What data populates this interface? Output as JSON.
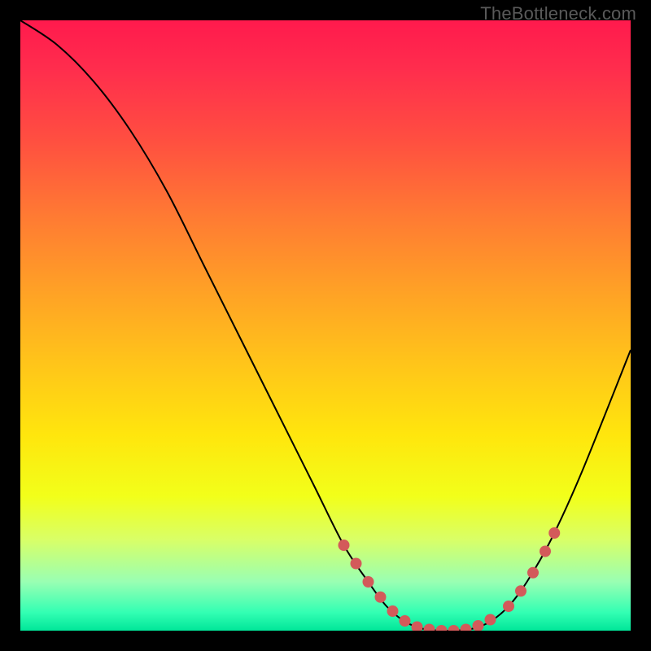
{
  "watermark": "TheBottleneck.com",
  "chart_data": {
    "type": "line",
    "title": "",
    "xlabel": "",
    "ylabel": "",
    "xlim": [
      0,
      100
    ],
    "ylim": [
      0,
      100
    ],
    "curve": [
      {
        "x": 0,
        "y": 100
      },
      {
        "x": 6,
        "y": 96
      },
      {
        "x": 12,
        "y": 90
      },
      {
        "x": 18,
        "y": 82
      },
      {
        "x": 24,
        "y": 72
      },
      {
        "x": 30,
        "y": 60
      },
      {
        "x": 36,
        "y": 48
      },
      {
        "x": 42,
        "y": 36
      },
      {
        "x": 48,
        "y": 24
      },
      {
        "x": 53,
        "y": 14
      },
      {
        "x": 57,
        "y": 8
      },
      {
        "x": 60,
        "y": 4
      },
      {
        "x": 63,
        "y": 1.5
      },
      {
        "x": 66,
        "y": 0.3
      },
      {
        "x": 70,
        "y": 0
      },
      {
        "x": 74,
        "y": 0.3
      },
      {
        "x": 77,
        "y": 1.5
      },
      {
        "x": 80,
        "y": 4
      },
      {
        "x": 83,
        "y": 8
      },
      {
        "x": 87,
        "y": 15
      },
      {
        "x": 92,
        "y": 26
      },
      {
        "x": 100,
        "y": 46
      }
    ],
    "highlight_dots": [
      {
        "x": 53,
        "y": 14
      },
      {
        "x": 55,
        "y": 11
      },
      {
        "x": 57,
        "y": 8
      },
      {
        "x": 59,
        "y": 5.5
      },
      {
        "x": 61,
        "y": 3.2
      },
      {
        "x": 63,
        "y": 1.6
      },
      {
        "x": 65,
        "y": 0.6
      },
      {
        "x": 67,
        "y": 0.2
      },
      {
        "x": 69,
        "y": 0
      },
      {
        "x": 71,
        "y": 0
      },
      {
        "x": 73,
        "y": 0.2
      },
      {
        "x": 75,
        "y": 0.8
      },
      {
        "x": 77,
        "y": 1.8
      },
      {
        "x": 80,
        "y": 4
      },
      {
        "x": 82,
        "y": 6.5
      },
      {
        "x": 84,
        "y": 9.5
      },
      {
        "x": 86,
        "y": 13
      },
      {
        "x": 87.5,
        "y": 16
      }
    ]
  }
}
